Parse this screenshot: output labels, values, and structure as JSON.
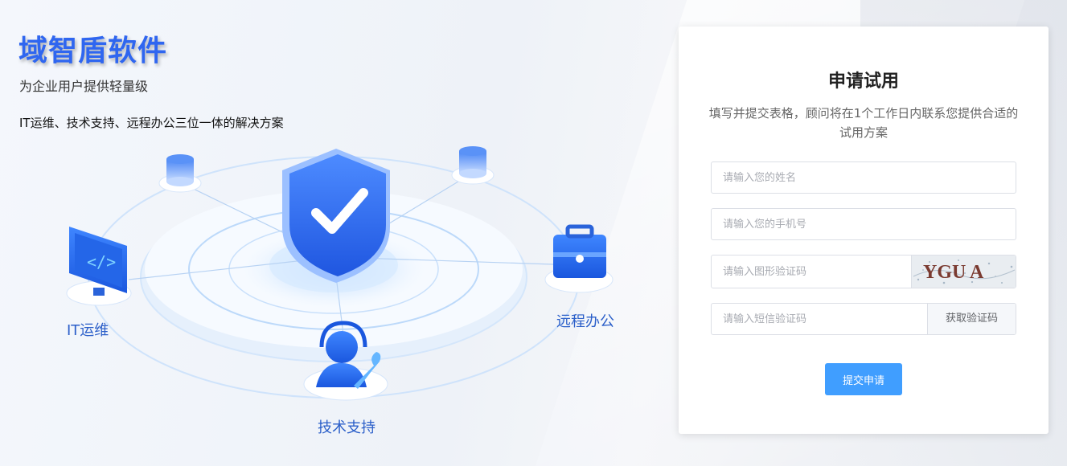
{
  "brand": {
    "title": "域智盾软件",
    "subtitle_line1": "为企业用户提供轻量级",
    "subtitle_line2": "IT运维、技术支持、远程办公三位一体的解决方案"
  },
  "illustration": {
    "labels": {
      "it_ops": "IT运维",
      "remote_office": "远程办公",
      "tech_support": "技术支持"
    },
    "icons": [
      "shield-check-icon",
      "database-icon",
      "monitor-code-icon",
      "briefcase-icon",
      "headset-wrench-icon"
    ]
  },
  "form": {
    "title": "申请试用",
    "description": "填写并提交表格，顾问将在1个工作日内联系您提供合适的试用方案",
    "name_placeholder": "请输入您的姓名",
    "phone_placeholder": "请输入您的手机号",
    "captcha_placeholder": "请输入图形验证码",
    "captcha_text": "YGU A",
    "sms_placeholder": "请输入短信验证码",
    "sms_button": "获取验证码",
    "submit_button": "提交申请"
  },
  "colors": {
    "brand_blue": "#2f66f0",
    "primary_button": "#409eff",
    "label_blue": "#2b5fc9"
  }
}
